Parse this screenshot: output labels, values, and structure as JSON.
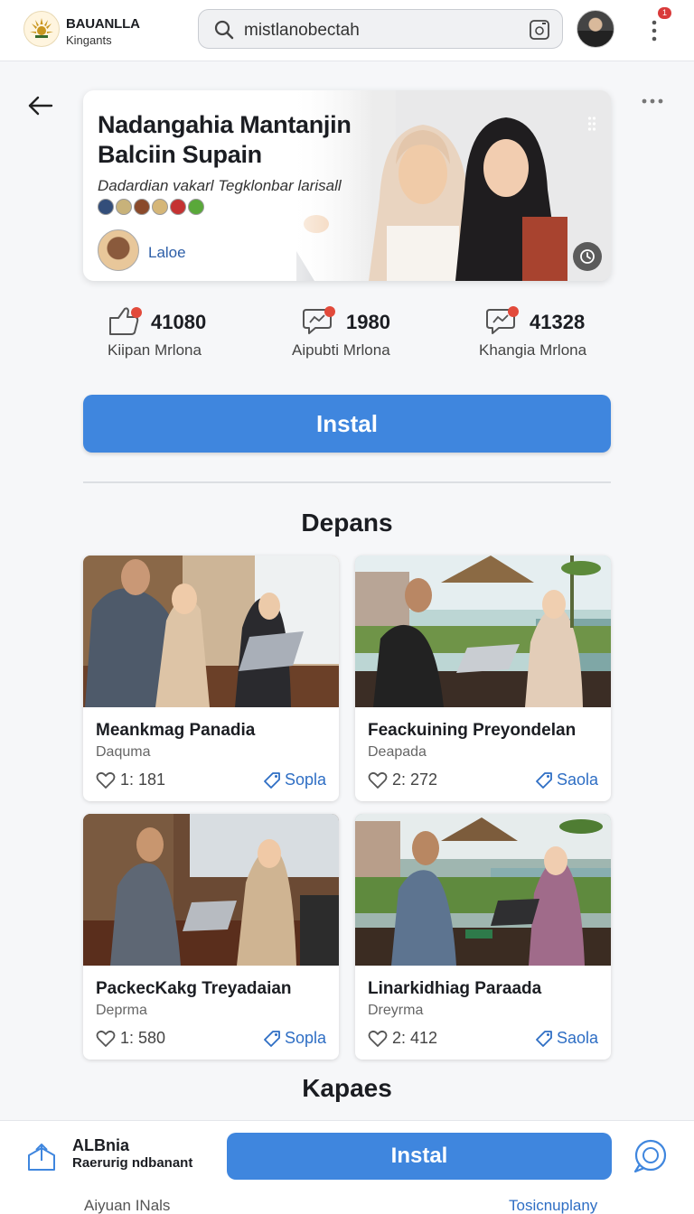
{
  "header": {
    "brand_name": "BAUANLLA",
    "brand_sub": "Kingants",
    "search_value": "mistlanobectah",
    "notification_count": "1"
  },
  "hero": {
    "title": "Nadangahia Mantanjin Balciin Supain",
    "subtitle": "Dadardian vakarl Tegklonbar larisall",
    "author": "Laloe"
  },
  "stats": [
    {
      "value": "41080",
      "label": "Kiipan Mrlona"
    },
    {
      "value": "1980",
      "label": "Aipubti Mrlona"
    },
    {
      "value": "41328",
      "label": "Khangia Mrlona"
    }
  ],
  "install_label": "Instal",
  "sections": {
    "first": "Depans",
    "second": "Kapaes"
  },
  "cards": [
    {
      "title": "Meankmag Panadia",
      "sub": "Daquma",
      "likes": "1: 181",
      "share": "Sopla"
    },
    {
      "title": "Feackuining Preyondelan",
      "sub": "Deapada",
      "likes": "2: 272",
      "share": "Saola"
    },
    {
      "title": "PackecKakg Treyadaian",
      "sub": "Deprma",
      "likes": "1: 580",
      "share": "Sopla"
    },
    {
      "title": "Linarkidhiag Paraada",
      "sub": "Dreyrma",
      "likes": "2: 412",
      "share": "Saola"
    }
  ],
  "bottom": {
    "name": "ALBnia",
    "sub": "Raerurig ndbanant",
    "install_label": "Instal",
    "left_link": "Aiyuan INals",
    "right_link": "Tosicnuplany"
  },
  "colors": {
    "accent": "#3f86de",
    "link": "#2e6ec4",
    "badge": "#d93a3a"
  }
}
